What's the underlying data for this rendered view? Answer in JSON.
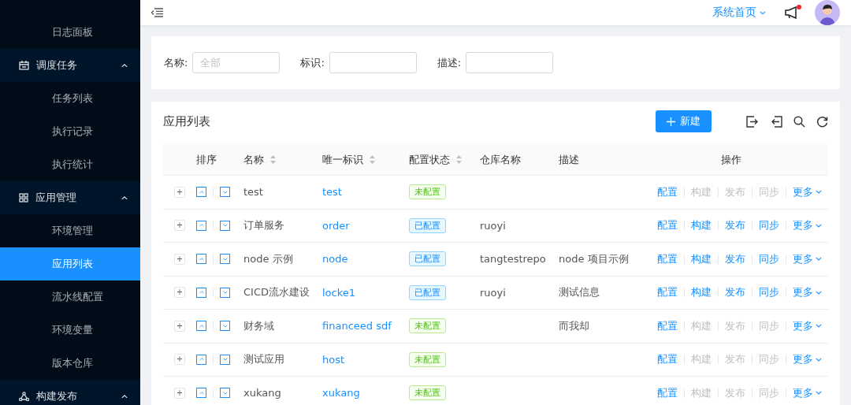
{
  "sidebar": {
    "items": [
      {
        "kind": "sub",
        "label": "日志面板",
        "selected": false
      },
      {
        "kind": "group",
        "label": "调度任务",
        "expanded": true
      },
      {
        "kind": "sub",
        "label": "任务列表",
        "selected": false
      },
      {
        "kind": "sub",
        "label": "执行记录",
        "selected": false
      },
      {
        "kind": "sub",
        "label": "执行统计",
        "selected": false
      },
      {
        "kind": "group",
        "label": "应用管理",
        "expanded": true
      },
      {
        "kind": "sub",
        "label": "环境管理",
        "selected": false
      },
      {
        "kind": "sub",
        "label": "应用列表",
        "selected": true
      },
      {
        "kind": "sub",
        "label": "流水线配置",
        "selected": false
      },
      {
        "kind": "sub",
        "label": "环境变量",
        "selected": false
      },
      {
        "kind": "sub",
        "label": "版本仓库",
        "selected": false
      },
      {
        "kind": "group",
        "label": "构建发布",
        "expanded": true
      }
    ]
  },
  "header": {
    "home_link": "系统首页",
    "has_notification": true
  },
  "filters": [
    {
      "label": "名称:",
      "placeholder": "全部"
    },
    {
      "label": "标识:"
    },
    {
      "label": "描述:"
    }
  ],
  "table": {
    "title": "应用列表",
    "new_button": "新建",
    "columns": [
      {
        "label": "排序",
        "sortable": false
      },
      {
        "label": "名称",
        "sortable": true
      },
      {
        "label": "唯一标识",
        "sortable": true
      },
      {
        "label": "配置状态",
        "sortable": true
      },
      {
        "label": "仓库名称",
        "sortable": false
      },
      {
        "label": "描述",
        "sortable": false
      },
      {
        "label": "操作",
        "sortable": false
      }
    ],
    "rows": [
      {
        "expand": "+",
        "name": "test",
        "key": "test",
        "status": "未配置",
        "configured": false,
        "repo": "",
        "desc": "",
        "actions": [
          {
            "label": "配置",
            "disabled": false
          },
          {
            "label": "构建",
            "disabled": true
          },
          {
            "label": "发布",
            "disabled": true
          },
          {
            "label": "同步",
            "disabled": true
          },
          {
            "label": "更多",
            "disabled": false
          }
        ]
      },
      {
        "expand": "+",
        "name": "订单服务",
        "key": "order",
        "status": "已配置",
        "configured": true,
        "repo": "ruoyi",
        "desc": "",
        "actions": [
          {
            "label": "配置",
            "disabled": false
          },
          {
            "label": "构建",
            "disabled": false
          },
          {
            "label": "发布",
            "disabled": false
          },
          {
            "label": "同步",
            "disabled": false
          },
          {
            "label": "更多",
            "disabled": false
          }
        ]
      },
      {
        "expand": "+",
        "name": "node 示例",
        "key": "node",
        "status": "已配置",
        "configured": true,
        "repo": "tangtestrepo",
        "desc": "node 项目示例",
        "actions": [
          {
            "label": "配置",
            "disabled": false
          },
          {
            "label": "构建",
            "disabled": false
          },
          {
            "label": "发布",
            "disabled": false
          },
          {
            "label": "同步",
            "disabled": false
          },
          {
            "label": "更多",
            "disabled": false
          }
        ]
      },
      {
        "expand": "+",
        "name": "CICD流水建设",
        "key": "locke1",
        "status": "已配置",
        "configured": true,
        "repo": "ruoyi",
        "desc": "测试信息",
        "actions": [
          {
            "label": "配置",
            "disabled": false
          },
          {
            "label": "构建",
            "disabled": false
          },
          {
            "label": "发布",
            "disabled": false
          },
          {
            "label": "同步",
            "disabled": false
          },
          {
            "label": "更多",
            "disabled": false
          }
        ]
      },
      {
        "expand": "+",
        "name": "财务域",
        "key": "financeed sdf",
        "status": "未配置",
        "configured": false,
        "repo": "",
        "desc": "而我却",
        "actions": [
          {
            "label": "配置",
            "disabled": false
          },
          {
            "label": "构建",
            "disabled": true
          },
          {
            "label": "发布",
            "disabled": true
          },
          {
            "label": "同步",
            "disabled": true
          },
          {
            "label": "更多",
            "disabled": false
          }
        ]
      },
      {
        "expand": "+",
        "name": "测试应用",
        "key": "host",
        "status": "未配置",
        "configured": false,
        "repo": "",
        "desc": "",
        "actions": [
          {
            "label": "配置",
            "disabled": false
          },
          {
            "label": "构建",
            "disabled": true
          },
          {
            "label": "发布",
            "disabled": true
          },
          {
            "label": "同步",
            "disabled": true
          },
          {
            "label": "更多",
            "disabled": false
          }
        ]
      },
      {
        "expand": "+",
        "name": "xukang",
        "key": "xukang",
        "status": "未配置",
        "configured": false,
        "repo": "",
        "desc": "",
        "actions": [
          {
            "label": "配置",
            "disabled": false
          },
          {
            "label": "构建",
            "disabled": true
          },
          {
            "label": "发布",
            "disabled": true
          },
          {
            "label": "同步",
            "disabled": true
          },
          {
            "label": "更多",
            "disabled": false
          }
        ]
      }
    ]
  }
}
